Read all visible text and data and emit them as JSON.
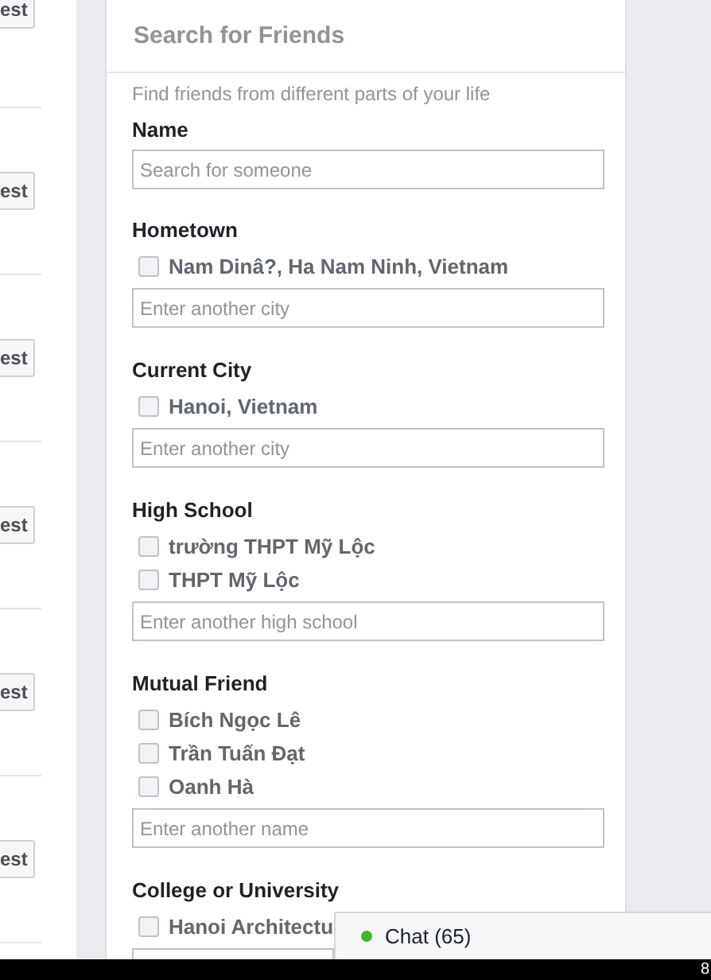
{
  "left_column": {
    "buttons": [
      "est",
      "est",
      "est",
      "est",
      "est",
      "est"
    ]
  },
  "panel": {
    "title": "Search for Friends",
    "description": "Find friends from different parts of your life",
    "sections": [
      {
        "label": "Name",
        "placeholder": "Search for someone"
      },
      {
        "label": "Hometown",
        "options": [
          {
            "label": "Nam Dinâ?, Ha Nam Ninh, Vietnam",
            "checked": false
          }
        ],
        "placeholder": "Enter another city"
      },
      {
        "label": "Current City",
        "options": [
          {
            "label": "Hanoi, Vietnam",
            "checked": false
          }
        ],
        "placeholder": "Enter another city"
      },
      {
        "label": "High School",
        "options": [
          {
            "label": "trường THPT Mỹ Lộc",
            "checked": false
          },
          {
            "label": "THPT Mỹ Lộc",
            "checked": false
          }
        ],
        "placeholder": "Enter another high school"
      },
      {
        "label": "Mutual Friend",
        "options": [
          {
            "label": "Bích Ngọc Lê",
            "checked": false
          },
          {
            "label": "Trần Tuấn Đạt",
            "checked": false
          },
          {
            "label": "Oanh Hà",
            "checked": false
          }
        ],
        "placeholder": "Enter another name"
      },
      {
        "label": "College or University",
        "options": [
          {
            "label": "Hanoi Architectu",
            "checked": false
          }
        ]
      }
    ]
  },
  "chat": {
    "label": "Chat (65)"
  },
  "taskbar": {
    "clock": "8"
  }
}
